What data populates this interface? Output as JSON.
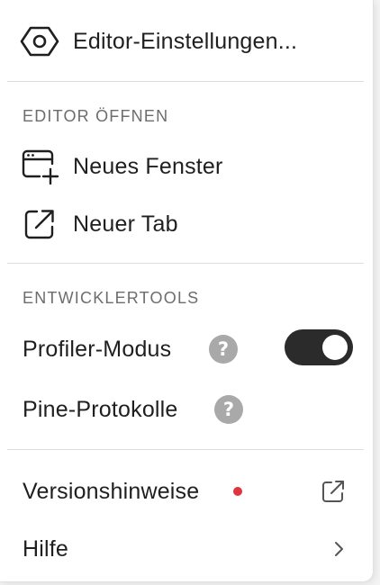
{
  "menu": {
    "settings": {
      "label": "Editor-Einstellungen...",
      "icon": "hexagon-settings-icon"
    },
    "open_editor": {
      "title": "EDITOR ÖFFNEN",
      "items": [
        {
          "label": "Neues Fenster",
          "icon": "new-window-icon"
        },
        {
          "label": "Neuer Tab",
          "icon": "external-open-icon"
        }
      ]
    },
    "devtools": {
      "title": "ENTWICKLERTOOLS",
      "profiler": {
        "label": "Profiler-Modus",
        "help": "?",
        "toggle_on": true
      },
      "pine_logs": {
        "label": "Pine-Protokolle",
        "help": "?"
      }
    },
    "release_notes": {
      "label": "Versionshinweise",
      "badge_color": "#e0343e",
      "icon": "external-link-icon"
    },
    "help": {
      "label": "Hilfe",
      "icon": "chevron-right-icon"
    }
  },
  "colors": {
    "text": "#1f1f1f",
    "section_title": "#6d6d6d",
    "toggle_bg": "#2b2b2b",
    "help_icon_bg": "#a9a9a9",
    "badge": "#e0343e"
  }
}
